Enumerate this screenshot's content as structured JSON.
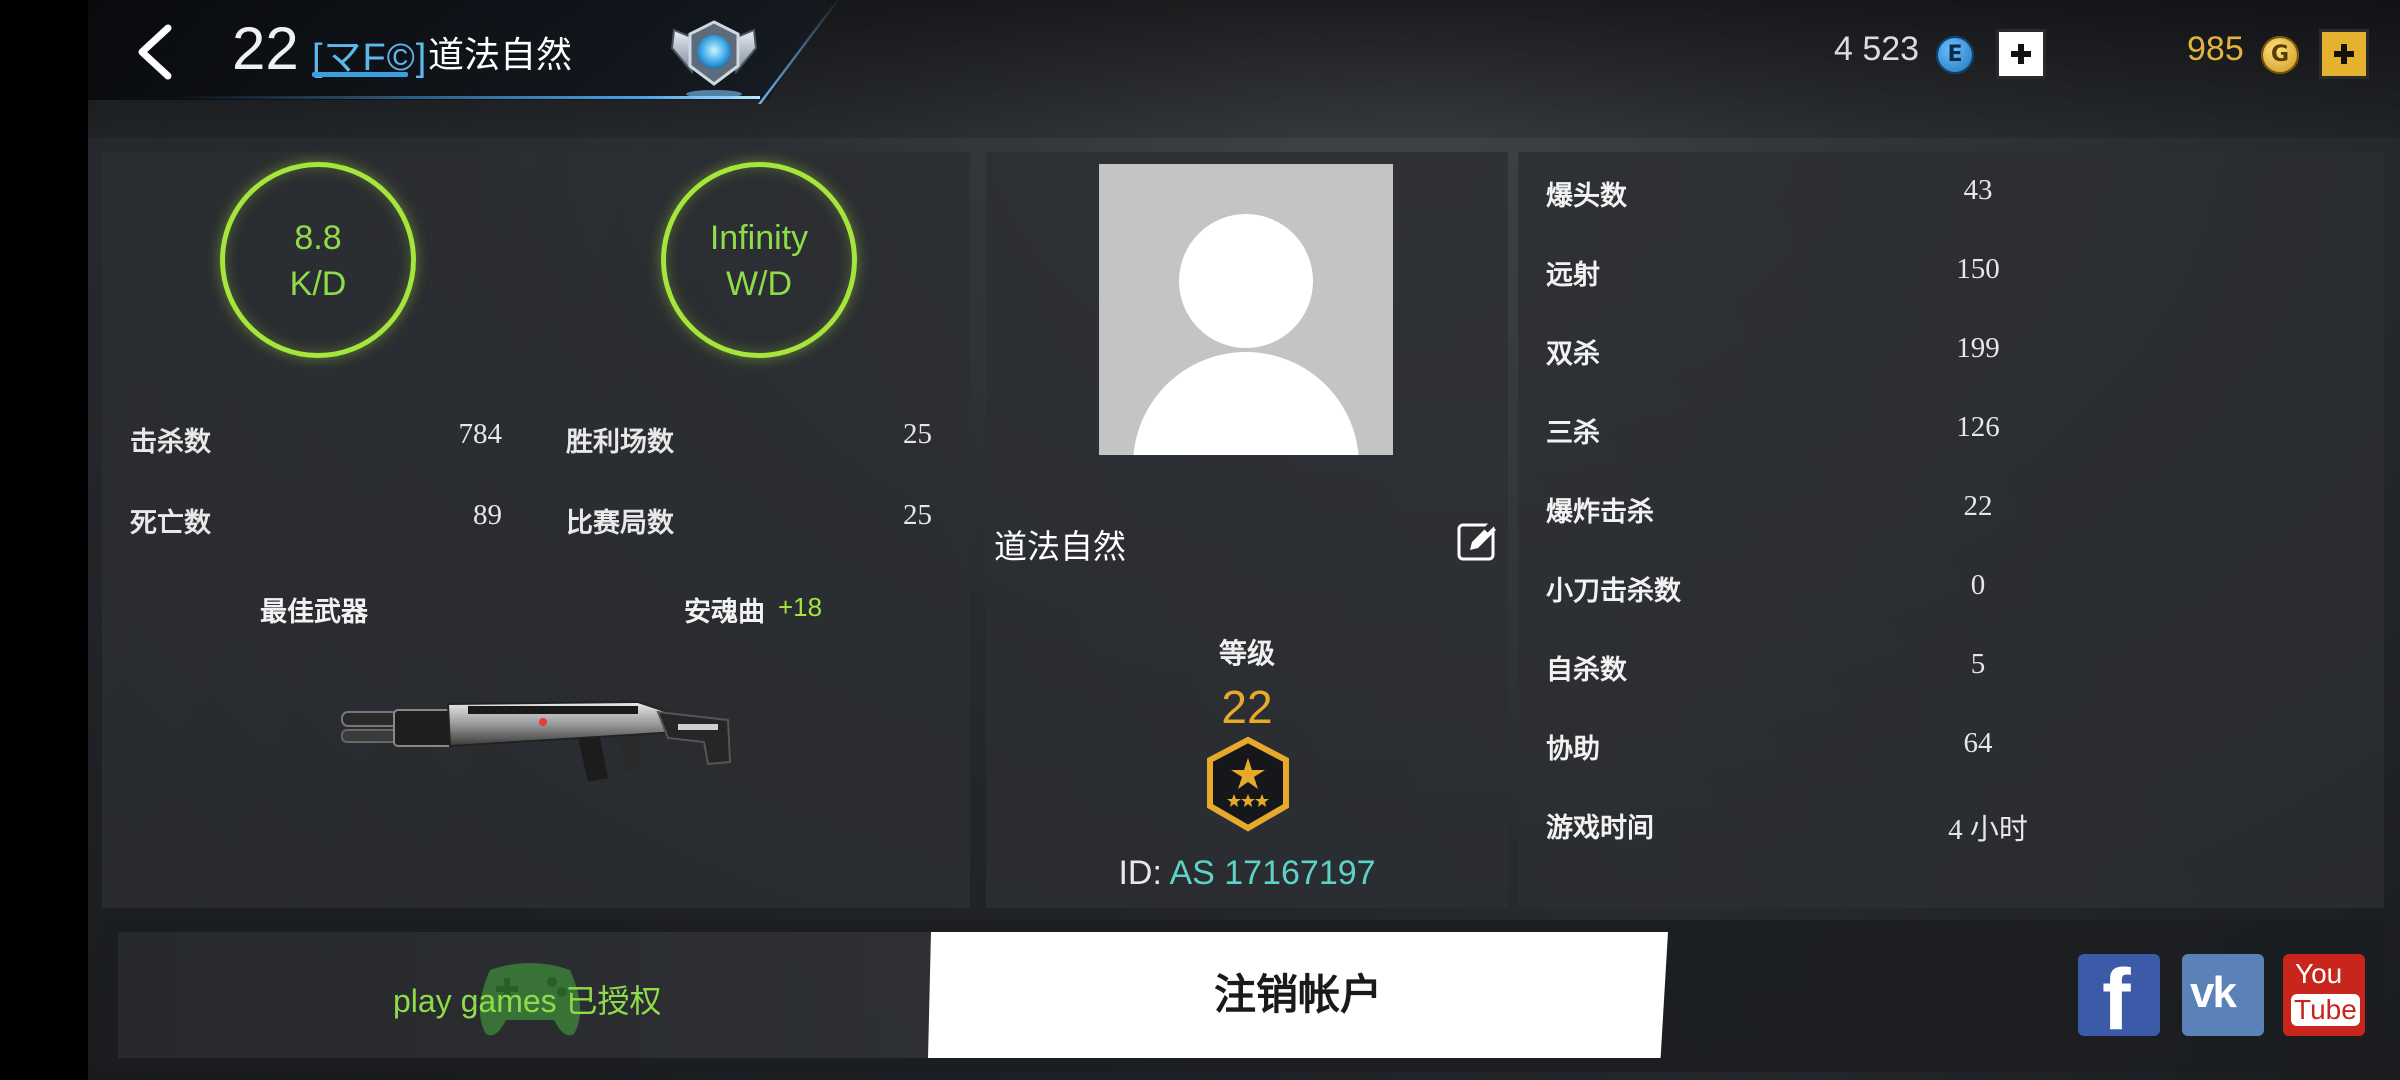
{
  "header": {
    "level": "22",
    "clan_tag": "[マF©]",
    "player_name": "道法自然",
    "currency_e": {
      "value": "4 523",
      "icon": "e-credit-coin-icon"
    },
    "currency_g": {
      "value": "985",
      "icon": "gold-coin-icon"
    },
    "colors": {
      "clan": "#5db8ec",
      "gold": "#e3b33c",
      "accent_green": "#a6e53c"
    }
  },
  "left_panel": {
    "kd": {
      "value": "8.8",
      "label": "K/D"
    },
    "wd": {
      "value": "Infinity",
      "label": "W/D"
    },
    "stats_left": [
      {
        "label": "击杀数",
        "value": "784"
      },
      {
        "label": "死亡数",
        "value": "89"
      }
    ],
    "stats_right": [
      {
        "label": "胜利场数",
        "value": "25"
      },
      {
        "label": "比赛局数",
        "value": "25"
      }
    ],
    "best_weapon_label": "最佳武器",
    "weapon_name": "安魂曲",
    "weapon_bonus": "+18"
  },
  "middle_panel": {
    "player_name": "道法自然",
    "level_title": "等级",
    "level_value": "22",
    "id_label": "ID:",
    "id_value": "AS 17167197"
  },
  "right_panel": {
    "stats": [
      {
        "label": "爆头数",
        "value": "43"
      },
      {
        "label": "远射",
        "value": "150"
      },
      {
        "label": "双杀",
        "value": "199"
      },
      {
        "label": "三杀",
        "value": "126"
      },
      {
        "label": "爆炸击杀",
        "value": "22"
      },
      {
        "label": "小刀击杀数",
        "value": "0"
      },
      {
        "label": "自杀数",
        "value": "5"
      },
      {
        "label": "协助",
        "value": "64"
      },
      {
        "label": "游戏时间",
        "value": "4 小时"
      }
    ]
  },
  "bottom": {
    "play_games_text": "play games",
    "authorized_text": "已授权",
    "logout_label": "注销帐户",
    "social": {
      "facebook_glyph": "f",
      "vk_glyph": "vk",
      "youtube_top": "You",
      "youtube_bottom": "Tube"
    }
  }
}
